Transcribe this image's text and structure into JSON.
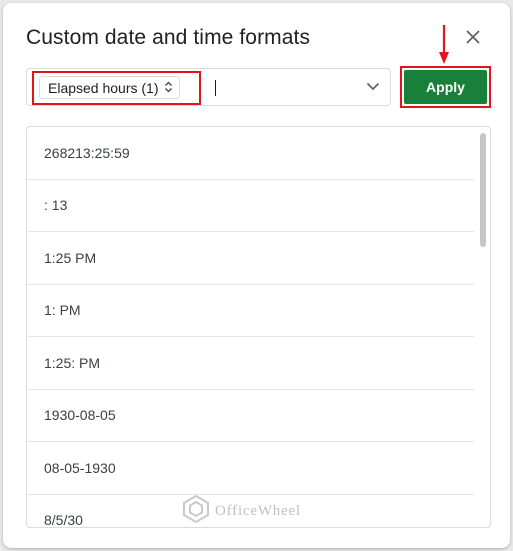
{
  "dialog": {
    "title": "Custom date and time formats",
    "format_chip_label": "Elapsed hours (1)",
    "apply_label": "Apply"
  },
  "formats": [
    "268213:25:59",
    ": 13",
    "1:25 PM",
    "1: PM",
    "1:25: PM",
    "1930-08-05",
    "08-05-1930",
    "8/5/30"
  ],
  "watermark": "OfficeWheel",
  "icons": {
    "close": "close-icon",
    "chip_stepper": "up-down-chevron-icon",
    "dropdown": "chevron-down-icon",
    "annotation_arrow": "arrow-down-icon"
  },
  "colors": {
    "apply_bg": "#188038",
    "highlight": "#e0161b",
    "title": "#202124"
  }
}
